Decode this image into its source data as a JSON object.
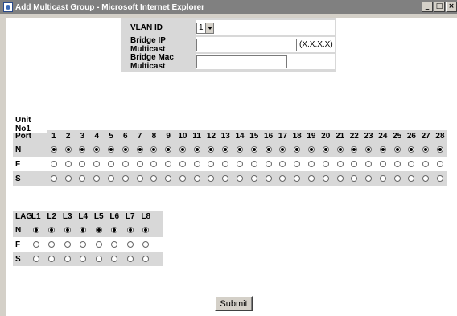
{
  "window": {
    "title": "Add Multicast Group - Microsoft Internet Explorer",
    "controls": [
      "_",
      "□",
      "×"
    ]
  },
  "form": {
    "vlan_label": "VLAN ID",
    "vlan_value": "1",
    "ip_label": "Bridge IP Multicast",
    "ip_value": "",
    "ip_hint": "(X.X.X.X)",
    "mac_label": "Bridge Mac Multicast",
    "mac_value": ""
  },
  "ports": {
    "unit_label": "Unit No1",
    "port_label": "Port",
    "numbers": [
      "1",
      "2",
      "3",
      "4",
      "5",
      "6",
      "7",
      "8",
      "9",
      "10",
      "11",
      "12",
      "13",
      "14",
      "15",
      "16",
      "17",
      "18",
      "19",
      "20",
      "21",
      "22",
      "23",
      "24",
      "25",
      "26",
      "27",
      "28"
    ],
    "rows": [
      {
        "label": "N",
        "selected": true
      },
      {
        "label": "F",
        "selected": false
      },
      {
        "label": "S",
        "selected": false
      }
    ]
  },
  "lags": {
    "header_label": "LAG",
    "names": [
      "L1",
      "L2",
      "L3",
      "L4",
      "L5",
      "L6",
      "L7",
      "L8"
    ],
    "rows": [
      {
        "label": "N",
        "selected": true
      },
      {
        "label": "F",
        "selected": false
      },
      {
        "label": "S",
        "selected": false
      }
    ]
  },
  "submit_label": "Submit"
}
